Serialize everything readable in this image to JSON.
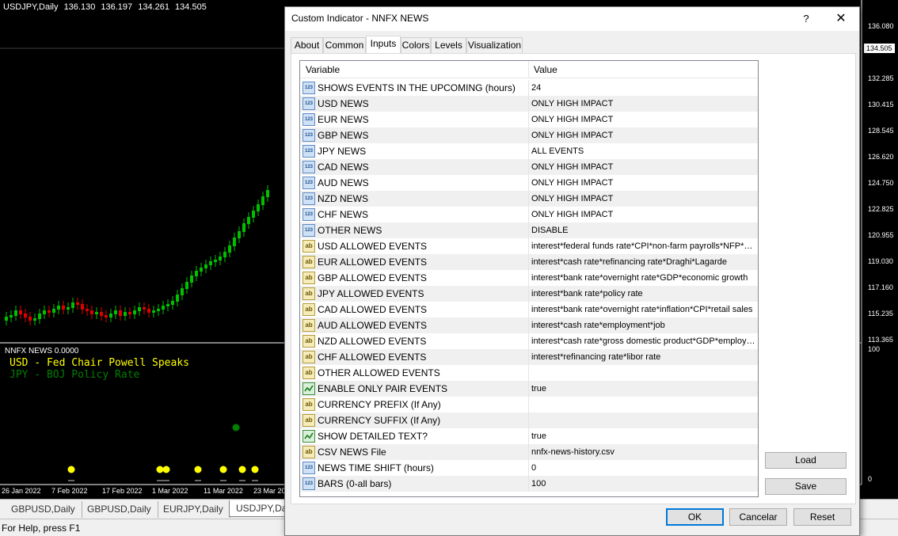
{
  "chart": {
    "symbol_info": "USDJPY,Daily",
    "ohlc": [
      "136.130",
      "136.197",
      "134.261",
      "134.505"
    ],
    "current_price": "134.505",
    "price_labels": [
      "136.080",
      "132.285",
      "130.415",
      "128.545",
      "126.620",
      "124.750",
      "122.825",
      "120.955",
      "119.030",
      "117.160",
      "115.235",
      "113.365"
    ],
    "subwindow": {
      "label": "NNFX NEWS 0.0000",
      "line1": "USD - Fed Chair Powell Speaks",
      "line2": "JPY - BOJ Policy Rate",
      "scale_top": "100",
      "scale_bottom": "0"
    },
    "dates": [
      "26 Jan 2022",
      "7 Feb 2022",
      "17 Feb 2022",
      "1 Mar 2022",
      "11 Mar 2022",
      "23 Mar 20"
    ],
    "colors": {
      "bull": "#00c000",
      "bear": "#e00000",
      "dot_yellow": "#ffff00",
      "dot_green": "#008000"
    }
  },
  "tabs_bottom": [
    "GBPUSD,Daily",
    "GBPUSD,Daily",
    "EURJPY,Daily",
    "USDJPY,Dai"
  ],
  "status": "For Help, press F1",
  "dialog": {
    "title": "Custom Indicator - NNFX NEWS",
    "help": "?",
    "close": "✕",
    "tabs": [
      "About",
      "Common",
      "Inputs",
      "Colors",
      "Levels",
      "Visualization"
    ],
    "active_tab": "Inputs",
    "columns": {
      "variable": "Variable",
      "value": "Value"
    },
    "rows": [
      {
        "type": "int",
        "variable": "SHOWS EVENTS IN THE UPCOMING (hours)",
        "value": "24"
      },
      {
        "type": "int",
        "variable": "USD NEWS",
        "value": "ONLY HIGH IMPACT"
      },
      {
        "type": "int",
        "variable": "EUR NEWS",
        "value": "ONLY HIGH IMPACT"
      },
      {
        "type": "int",
        "variable": "GBP NEWS",
        "value": "ONLY HIGH IMPACT"
      },
      {
        "type": "int",
        "variable": "JPY NEWS",
        "value": "ALL EVENTS"
      },
      {
        "type": "int",
        "variable": "CAD NEWS",
        "value": "ONLY HIGH IMPACT"
      },
      {
        "type": "int",
        "variable": "AUD NEWS",
        "value": "ONLY HIGH IMPACT"
      },
      {
        "type": "int",
        "variable": "NZD NEWS",
        "value": "ONLY HIGH IMPACT"
      },
      {
        "type": "int",
        "variable": "CHF NEWS",
        "value": "ONLY HIGH IMPACT"
      },
      {
        "type": "int",
        "variable": "OTHER NEWS",
        "value": "DISABLE"
      },
      {
        "type": "str",
        "variable": "USD ALLOWED EVENTS",
        "value": "interest*federal funds rate*CPI*non-farm payrolls*NFP*Yell..."
      },
      {
        "type": "str",
        "variable": "EUR ALLOWED EVENTS",
        "value": "interest*cash rate*refinancing rate*Draghi*Lagarde"
      },
      {
        "type": "str",
        "variable": "GBP ALLOWED EVENTS",
        "value": "interest*bank rate*overnight rate*GDP*economic growth"
      },
      {
        "type": "str",
        "variable": "JPY ALLOWED EVENTS",
        "value": "interest*bank rate*policy rate"
      },
      {
        "type": "str",
        "variable": "CAD ALLOWED EVENTS",
        "value": "interest*bank rate*overnight rate*inflation*CPI*retail sales"
      },
      {
        "type": "str",
        "variable": "AUD ALLOWED EVENTS",
        "value": "interest*cash rate*employment*job"
      },
      {
        "type": "str",
        "variable": "NZD ALLOWED EVENTS",
        "value": "interest*cash rate*gross domestic product*GDP*employm..."
      },
      {
        "type": "str",
        "variable": "CHF ALLOWED EVENTS",
        "value": "interest*refinancing rate*libor rate"
      },
      {
        "type": "str",
        "variable": "OTHER ALLOWED EVENTS",
        "value": ""
      },
      {
        "type": "bool",
        "variable": "ENABLE ONLY PAIR EVENTS",
        "value": "true"
      },
      {
        "type": "str",
        "variable": "CURRENCY PREFIX (If Any)",
        "value": ""
      },
      {
        "type": "str",
        "variable": "CURRENCY SUFFIX (If Any)",
        "value": ""
      },
      {
        "type": "bool",
        "variable": "SHOW DETAILED TEXT?",
        "value": "true"
      },
      {
        "type": "str",
        "variable": "CSV NEWS File",
        "value": "nnfx-news-history.csv"
      },
      {
        "type": "int",
        "variable": "NEWS TIME SHIFT (hours)",
        "value": "0"
      },
      {
        "type": "int",
        "variable": "BARS (0-all bars)",
        "value": "100"
      }
    ],
    "icon_text": {
      "int": "123",
      "str": "ab"
    },
    "buttons": {
      "load": "Load",
      "save": "Save",
      "ok": "OK",
      "cancel": "Cancelar",
      "reset": "Reset"
    }
  }
}
